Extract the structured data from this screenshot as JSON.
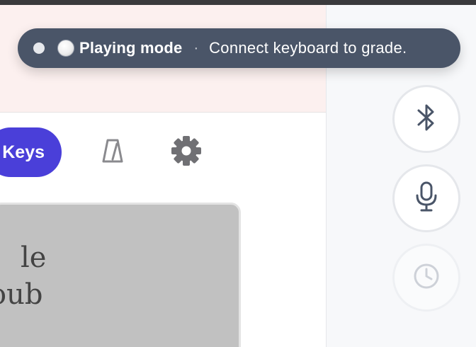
{
  "toast": {
    "status_dot_color": "#e6e8ec",
    "mode_icon": "white-circle-icon",
    "mode_label": "Playing mode",
    "separator": "·",
    "message": "Connect keyboard to grade."
  },
  "toolbar": {
    "keys_label": "Keys",
    "keys_color": "#4a3fd9",
    "metronome_icon": "metronome-icon",
    "settings_icon": "gear-icon"
  },
  "sheet": {
    "lines": [
      "le",
      "oub"
    ]
  },
  "side_panel": {
    "buttons": [
      {
        "icon": "bluetooth-icon",
        "enabled": true
      },
      {
        "icon": "microphone-icon",
        "enabled": true
      },
      {
        "icon": "clock-icon",
        "enabled": false
      }
    ]
  }
}
